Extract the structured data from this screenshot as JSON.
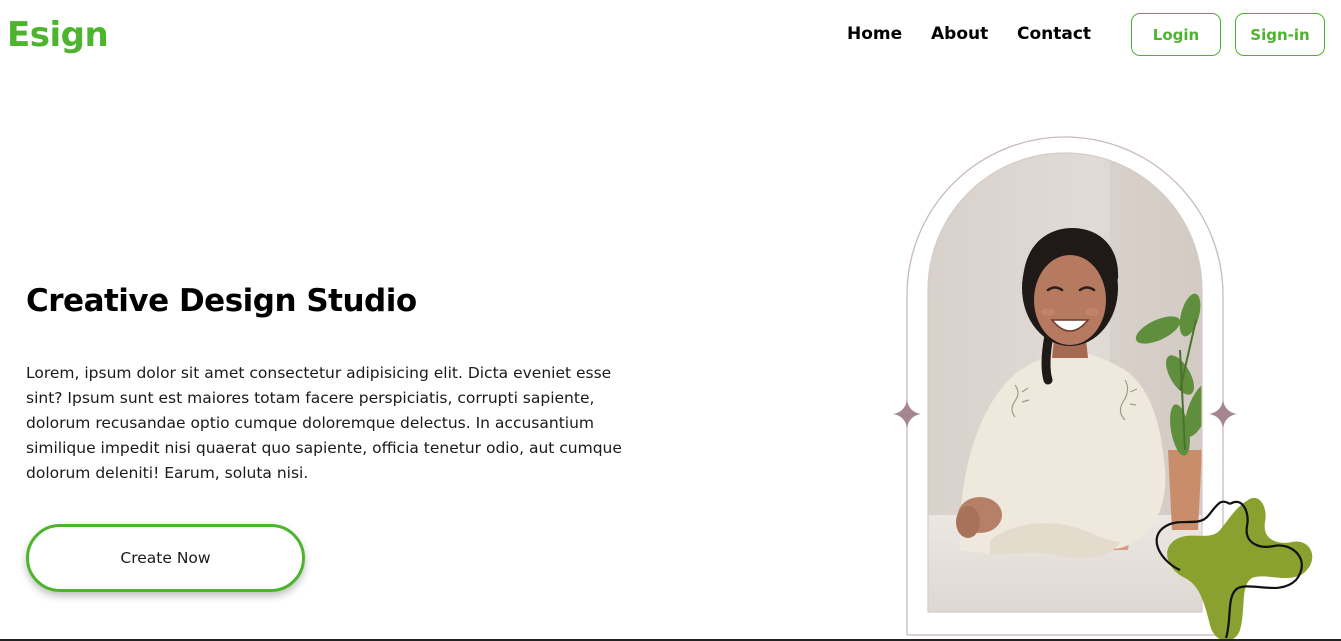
{
  "brand": {
    "name": "Esign",
    "color": "#4cb52d"
  },
  "nav": {
    "links": [
      "Home",
      "About",
      "Contact"
    ],
    "login_label": "Login",
    "signin_label": "Sign-in"
  },
  "hero": {
    "title": "Creative Design Studio",
    "text": "Lorem, ipsum dolor sit amet consectetur adipisicing elit. Dicta eveniet esse sint? Ipsum sunt est maiores totam facere perspiciatis, corrupti sapiente, dolorum recusandae optio cumque doloremque delectus. In accusantium similique impedit nisi quaerat quo sapiente, officia tenetur odio, aut cumque dolorum deleniti! Earum, soluta nisi.",
    "cta_label": "Create Now"
  },
  "image": {
    "subject": "smiling woman seated at a table with potted plants",
    "frame_color": "#c9b8c0",
    "sparkle_color": "#a5858f",
    "blob_color": "#8ba12f"
  }
}
